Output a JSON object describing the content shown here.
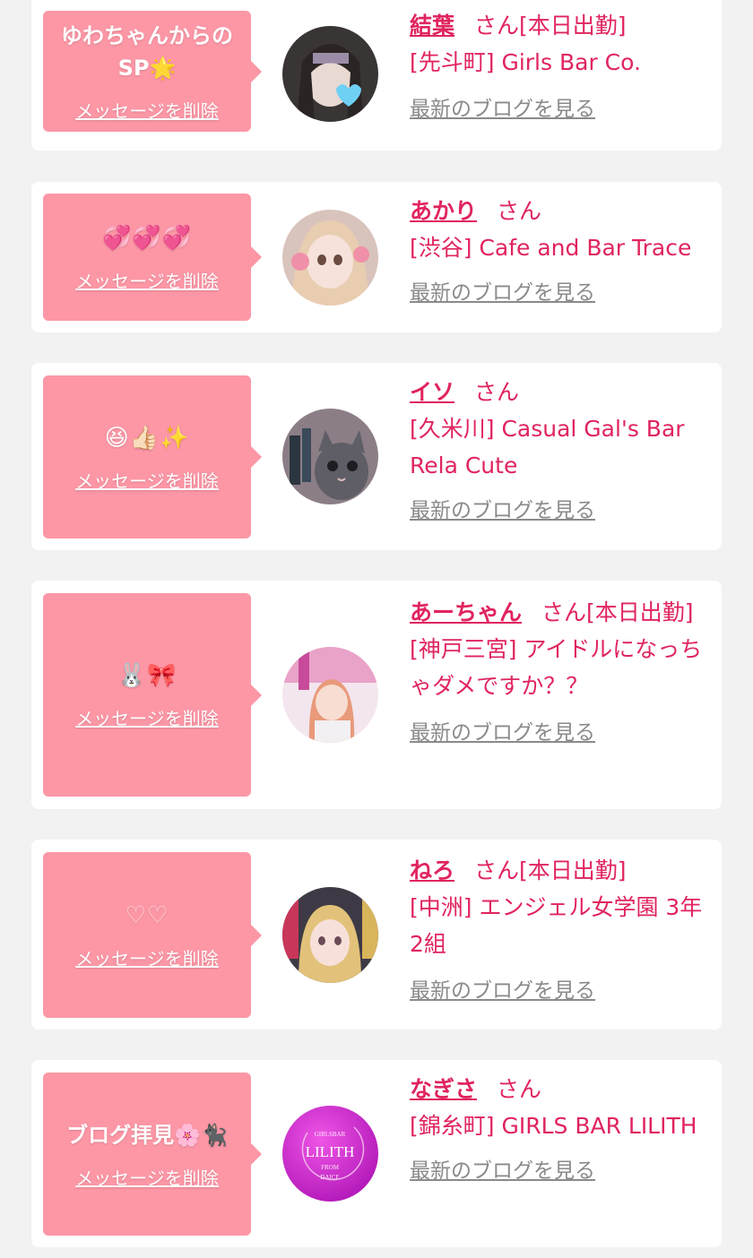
{
  "delete_label": "メッセージを削除",
  "blog_label": "最新のブログを見る",
  "san_label": "さん",
  "items": [
    {
      "message": "ゆわちゃんからのSP🌟",
      "name": "結葉",
      "status": "[本日出勤]",
      "shop": "[先斗町] Girls Bar Co."
    },
    {
      "message": "💞💞💞",
      "name": "あかり",
      "status": "",
      "shop": "[渋谷] Cafe and Bar Trace"
    },
    {
      "message": "😆👍🏻✨",
      "name": "イソ",
      "status": "",
      "shop": "[久米川] Casual Gal's Bar Rela Cute"
    },
    {
      "message": "🐰🎀",
      "name": "あーちゃん",
      "status": "[本日出勤]",
      "shop": "[神戸三宮] アイドルになっちゃダメですか？？"
    },
    {
      "message": "♡♡",
      "name": "ねろ",
      "status": "[本日出勤]",
      "shop": "[中洲] エンジェル女学園 3年2組"
    },
    {
      "message": "ブログ拝見🌸🐈‍⬛",
      "name": "なぎさ",
      "status": "",
      "shop": "[錦糸町] GIRLS BAR LILITH"
    }
  ],
  "logo_text": {
    "top": "GIRLSBAR",
    "main": "LILITH",
    "sub": "FROM",
    "bottom": "DAICE"
  },
  "colors": {
    "bubble": "#fd97a6",
    "accent": "#e0245e",
    "link_gray": "#8a8a8a",
    "background": "#f2f2f2"
  }
}
